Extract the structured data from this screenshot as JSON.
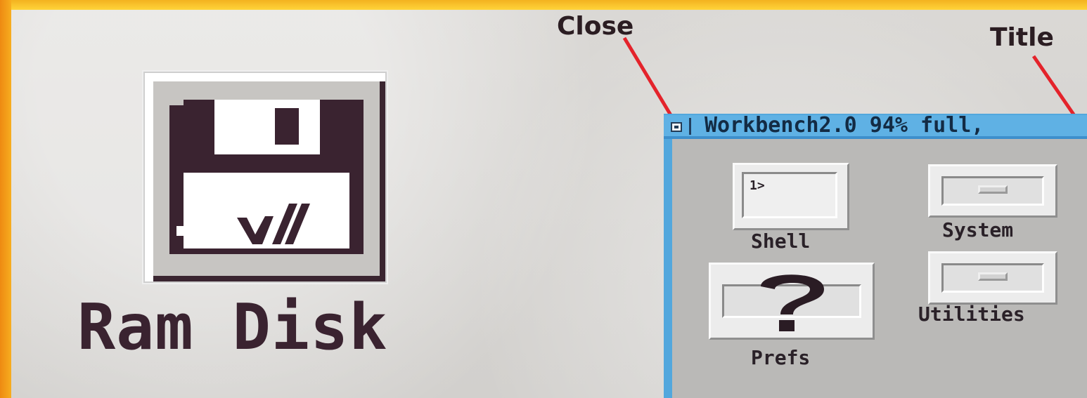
{
  "desktop": {
    "ram_disk_label": "Ram Disk"
  },
  "callouts": {
    "close": "Close",
    "title": "Title"
  },
  "window": {
    "title": "Workbench2.0   94% full,",
    "icons": [
      {
        "label": "Shell",
        "icon": "shell-icon"
      },
      {
        "label": "System",
        "icon": "drawer-icon"
      },
      {
        "label": "Prefs",
        "icon": "prefs-icon"
      },
      {
        "label": "Utilities",
        "icon": "drawer-icon"
      }
    ],
    "shell_prompt": "1>"
  },
  "colors": {
    "frame": "#f5a51a",
    "desktop": "#d7d5d2",
    "window_border": "#52a7dd",
    "text": "#2a2128",
    "pointer": "#e4232b"
  }
}
